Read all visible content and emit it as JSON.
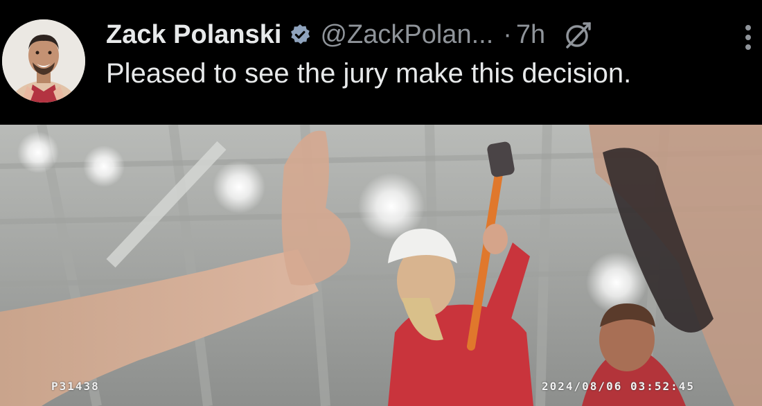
{
  "tweet": {
    "author_name": "Zack Polanski",
    "author_handle": "@ZackPolan...",
    "separator": "·",
    "time_ago": "7h",
    "text": "Pleased to see the jury make this decision."
  },
  "icons": {
    "verified": "verified-badge-icon",
    "grok": "grok-icon",
    "more": "more-options-icon"
  },
  "media": {
    "camera_id": "P31438",
    "timestamp": "2024/08/06 03:52:45"
  },
  "colors": {
    "background": "#000000",
    "text_primary": "#e7e9ea",
    "text_secondary": "#8f949a",
    "verified_badge": "#8fa3bd"
  }
}
